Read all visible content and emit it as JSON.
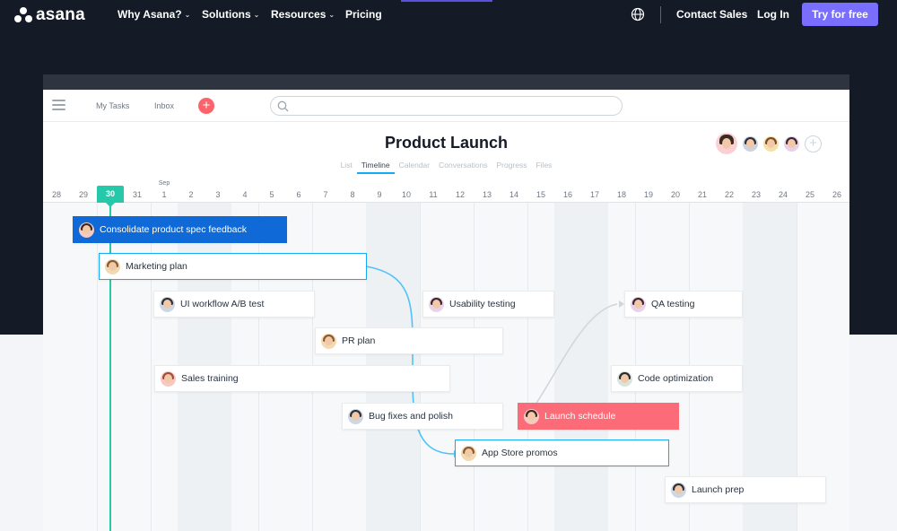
{
  "colors": {
    "nav_bg": "#151b26",
    "accent": "#796eff",
    "today": "#25c8a8",
    "blue_task": "#0f6ad8",
    "pink_task": "#fc6b78",
    "link": "#14aaf5"
  },
  "nav": {
    "brand": "asana",
    "items": [
      {
        "label": "Why Asana?",
        "has_menu": true
      },
      {
        "label": "Solutions",
        "has_menu": true
      },
      {
        "label": "Resources",
        "has_menu": true
      },
      {
        "label": "Pricing",
        "has_menu": false
      }
    ],
    "globe_icon": "globe-icon",
    "contact_label": "Contact Sales",
    "login_label": "Log In",
    "cta_label": "Try for free"
  },
  "app": {
    "my_tasks": "My Tasks",
    "inbox": "Inbox",
    "plus": "+",
    "search_placeholder": "",
    "project_title": "Product Launch",
    "tabs": [
      "List",
      "Timeline",
      "Calendar",
      "Conversations",
      "Progress",
      "Files"
    ],
    "active_tab": "Timeline",
    "add_member": "+"
  },
  "timeline": {
    "month_label": "Sep",
    "days": [
      "28",
      "29",
      "30",
      "31",
      "1",
      "2",
      "3",
      "4",
      "5",
      "6",
      "7",
      "8",
      "9",
      "10",
      "11",
      "12",
      "13",
      "14",
      "15",
      "16",
      "17",
      "18",
      "19",
      "20",
      "21",
      "22",
      "23",
      "24",
      "25",
      "26"
    ],
    "today": "30",
    "tasks": [
      {
        "name": "Consolidate product spec feedback",
        "style": "blue"
      },
      {
        "name": "Marketing plan",
        "style": "selected"
      },
      {
        "name": "UI workflow A/B test",
        "style": "normal"
      },
      {
        "name": "Usability testing",
        "style": "normal"
      },
      {
        "name": "QA testing",
        "style": "normal"
      },
      {
        "name": "PR plan",
        "style": "normal"
      },
      {
        "name": "Sales training",
        "style": "normal"
      },
      {
        "name": "Code optimization",
        "style": "normal"
      },
      {
        "name": "Bug fixes and polish",
        "style": "normal"
      },
      {
        "name": "Launch schedule",
        "style": "pink"
      },
      {
        "name": "App Store promos",
        "style": "selected"
      },
      {
        "name": "Launch prep",
        "style": "normal"
      }
    ]
  }
}
